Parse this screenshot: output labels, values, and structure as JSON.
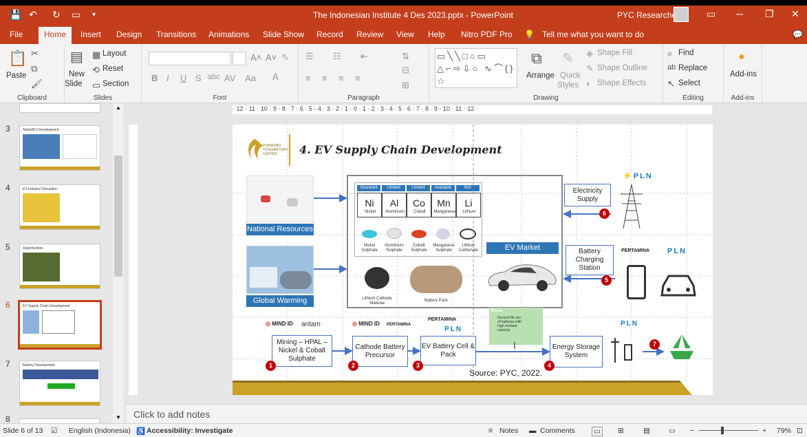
{
  "window": {
    "title": "The Indonesian Institute 4 Des 2023.pptx - PowerPoint",
    "user": "PYC Researcher"
  },
  "tabs": [
    "File",
    "Home",
    "Insert",
    "Design",
    "Transitions",
    "Animations",
    "Slide Show",
    "Record",
    "Review",
    "View",
    "Help",
    "Nitro PDF Pro"
  ],
  "tell_me": "Tell me what you want to do",
  "ribbon": {
    "clipboard": {
      "label": "Clipboard",
      "paste": "Paste"
    },
    "slides": {
      "label": "Slides",
      "new_slide": "New",
      "new_slide2": "Slide",
      "layout": "Layout",
      "reset": "Reset",
      "section": "Section"
    },
    "font": {
      "label": "Font"
    },
    "paragraph": {
      "label": "Paragraph"
    },
    "drawing": {
      "label": "Drawing",
      "arrange": "Arrange",
      "quick_styles": "Quick",
      "quick_styles2": "Styles",
      "shape_fill": "Shape Fill",
      "shape_outline": "Shape Outline",
      "shape_effects": "Shape Effects"
    },
    "editing": {
      "label": "Editing",
      "find": "Find",
      "replace": "Replace",
      "select": "Select"
    },
    "addins": {
      "label": "Add-ins",
      "addins_btn": "Add-ins"
    }
  },
  "thumbnails": [
    {
      "num": "3",
      "title": "Nickel/EV Development"
    },
    {
      "num": "4",
      "title": "EV Industry Disruption"
    },
    {
      "num": "5",
      "title": "Opportunities"
    },
    {
      "num": "6",
      "title": "EV Supply Chain Development"
    },
    {
      "num": "7",
      "title": "Battery Development"
    },
    {
      "num": "8",
      "title": ""
    }
  ],
  "ruler_text": "· 12 · 11 · 10 · 9 · 8 · 7 · 6 · 5 · 4 · 3 · 2 · 1 · 0 · 1 · 2 · 3 · 4 · 5 · 6 · 7 · 8 · 9 · 10 · 11 · 12 ·",
  "slide": {
    "title": "4. EV Supply Chain Development",
    "logo_text": "PURNOMO YUSGIANTORO CENTER",
    "national_resources": "National Resources",
    "global_warming": "Global Warming",
    "elements": [
      {
        "head": "Abundant",
        "sym": "Ni",
        "name": "Nickel"
      },
      {
        "head": "Limited",
        "sym": "Al",
        "name": "Aluminium"
      },
      {
        "head": "Limited",
        "sym": "Co",
        "name": "Cobalt"
      },
      {
        "head": "Available",
        "sym": "Mn",
        "name": "Manganese"
      },
      {
        "head": "N/A",
        "sym": "Li",
        "name": "Lithium"
      }
    ],
    "materials": [
      "Nickel Sulphate",
      "Aluminium Sulphate",
      "Cobalt Sulphate",
      "Manganese Sulphate",
      "Lithium Carbonate"
    ],
    "lithium_cathode": "Lithium Cathode Material",
    "battery_pack": "Battery Pack",
    "ev_market": "EV Market",
    "electricity_supply": "Electricity Supply",
    "battery_charging": "Battery Charging Station",
    "mining": "Mining – HPAL – Nickel & Cobalt Sulphate",
    "cathode": "Cathode Battery Precursor",
    "ev_battery": "EV Battery Cell & Pack",
    "energy_storage": "Energy Storage System",
    "reuse_title": "Reuse",
    "reuse_text": "Second life use of batteries with high residual capacity",
    "source": "Source: PYC, 2022.",
    "logos": {
      "pln": "PLN",
      "pertamina": "PERTAMINA",
      "mindid": "MIND ID",
      "antam": "antam"
    },
    "markers": [
      "1",
      "2",
      "3",
      "4",
      "5",
      "6",
      "7"
    ]
  },
  "notes_placeholder": "Click to add notes",
  "status": {
    "slide_of": "Slide 6 of 13",
    "language": "English (Indonesia)",
    "accessibility": "Accessibility: Investigate",
    "notes": "Notes",
    "comments": "Comments",
    "zoom": "79%"
  },
  "colors": {
    "accent": "#c43e1c",
    "slide_blue": "#2e75b6",
    "gold": "#c9a227",
    "marker_red": "#c00000"
  }
}
